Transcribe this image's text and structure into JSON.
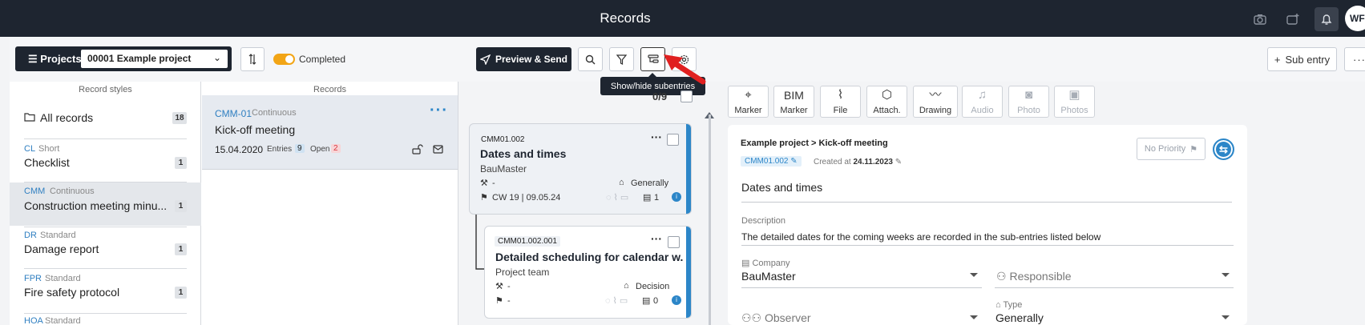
{
  "header": {
    "title": "Records",
    "avatar_initials": "WF"
  },
  "toolbar": {
    "projects_label": "Projects",
    "project_selected": "00001 Example project",
    "completed_label": "Completed",
    "completed_on": true,
    "preview_send_label": "Preview & Send",
    "sub_entry_label": "Sub entry",
    "tooltip": "Show/hide subentries"
  },
  "record_styles": {
    "heading": "Record styles",
    "all_records": {
      "label": "All records",
      "count": "18"
    },
    "items": [
      {
        "abbr": "CL",
        "type": "Short",
        "name": "Checklist",
        "count": "1"
      },
      {
        "abbr": "CMM",
        "type": "Continuous",
        "name": "Construction meeting minu...",
        "count": "1"
      },
      {
        "abbr": "DR",
        "type": "Standard",
        "name": "Damage report",
        "count": "1"
      },
      {
        "abbr": "FPR",
        "type": "Standard",
        "name": "Fire safety protocol",
        "count": "1"
      },
      {
        "abbr": "HOA",
        "type": "Standard",
        "name": "",
        "count": ""
      }
    ]
  },
  "records": {
    "heading": "Records",
    "card": {
      "code": "CMM-01",
      "type": "Continuous",
      "title": "Kick-off meeting",
      "date": "15.04.2020",
      "entries_label": "Entries",
      "entries_count": "9",
      "open_label": "Open",
      "open_count": "2"
    }
  },
  "entries": {
    "counter": "0/9",
    "items": [
      {
        "code": "CMM01.002",
        "title": "Dates and times",
        "company": "BauMaster",
        "responsible": "-",
        "tag": "Generally",
        "due": "CW 19 | 09.05.24",
        "subentries": "1"
      },
      {
        "code": "CMM01.002.001",
        "title": "Detailed scheduling for calendar w...",
        "company": "Project team",
        "responsible": "-",
        "tag": "Decision",
        "due": "-",
        "subentries": "0"
      }
    ]
  },
  "detail": {
    "tools": [
      {
        "icon": "📍",
        "label": "Marker",
        "disabled": false
      },
      {
        "icon": "BIM",
        "label": "Marker",
        "disabled": false
      },
      {
        "icon": "📎",
        "label": "File",
        "disabled": false
      },
      {
        "icon": "⬡",
        "label": "Attach.",
        "disabled": false
      },
      {
        "icon": "〰",
        "label": "Drawing",
        "disabled": false
      },
      {
        "icon": "🎤",
        "label": "Audio",
        "disabled": true
      },
      {
        "icon": "📷",
        "label": "Photo",
        "disabled": true
      },
      {
        "icon": "🖼",
        "label": "Photos",
        "disabled": true
      }
    ],
    "breadcrumb": "Example project > Kick-off meeting",
    "priority": "No Priority",
    "code": "CMM01.002",
    "created_label": "Created at",
    "created_date": "24.11.2023",
    "title": "Dates and times",
    "description_label": "Description",
    "description": "The detailed dates for the coming weeks are recorded in the sub-entries listed below",
    "company_label": "Company",
    "company": "BauMaster",
    "responsible_placeholder": "Responsible",
    "observer_placeholder": "Observer",
    "type_label": "Type",
    "type": "Generally"
  },
  "colors": {
    "dark": "#1e2530",
    "accent_blue": "#2c86c8",
    "toggle": "#f2a516",
    "open_red": "#d9363e",
    "annotation_arrow": "#e02020"
  }
}
